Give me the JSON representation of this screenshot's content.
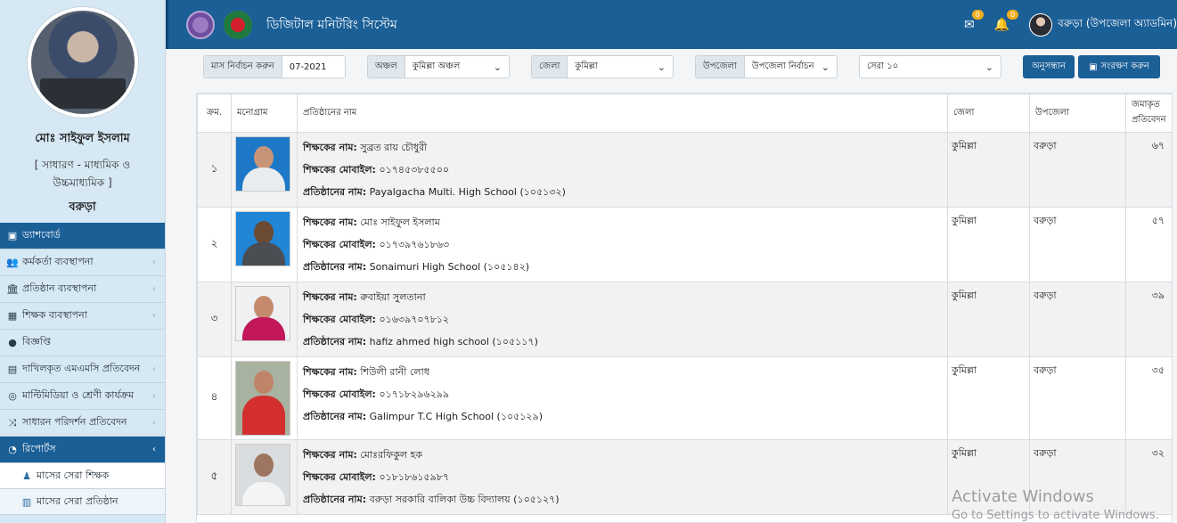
{
  "profile": {
    "name": "মোঃ সাইফুল ইসলাম",
    "category": "[ সাধারণ - মাধ্যমিক ও উচ্চমাধ্যমিক ]",
    "place": "বরুড়া"
  },
  "menu": [
    {
      "label": "ড্যাশবোর্ড",
      "icon": "dashboard-icon"
    },
    {
      "label": "কর্মকর্তা ব্যবস্থাপনা",
      "icon": "users-icon"
    },
    {
      "label": "প্রতিষ্ঠান ব্যবস্থাপনা",
      "icon": "institution-icon"
    },
    {
      "label": "শিক্ষক ব্যবস্থাপনা",
      "icon": "teacher-icon"
    },
    {
      "label": "বিজ্ঞপ্তি",
      "icon": "comment-icon"
    },
    {
      "label": "দাখিলকৃত এমএমসি প্রতিবেদন",
      "icon": "report-card-icon"
    },
    {
      "label": "মাল্টিমিডিয়া ও শ্রেণী কার্যক্রম",
      "icon": "multimedia-icon"
    },
    {
      "label": "সাধারন পরিদর্শন প্রতিবেদন",
      "icon": "shuffle-icon"
    },
    {
      "label": "রিপোর্টস",
      "icon": "pie-chart-icon"
    },
    {
      "label": "মাসের সেরা শিক্ষক",
      "icon": "teacher-small-icon"
    },
    {
      "label": "মাসের সেরা প্রতিষ্ঠান",
      "icon": "institution-small-icon"
    }
  ],
  "header": {
    "title": "ডিজিটাল মনিটরিং সিস্টেম",
    "mail_count": "0",
    "notif_count": "0",
    "user": "বরুড়া (উপজেলা অ্যাডমিন)"
  },
  "filters": {
    "month_label": "মাস নির্বাচন করুন",
    "month_value": "07-2021",
    "region_label": "অঞ্চল",
    "region_value": "কুমিল্লা অঞ্চল",
    "district_label": "জেলা",
    "district_value": "কুমিল্লা",
    "upazila_label": "উপজেলা",
    "upazila_value": "উপজেলা নির্বাচন",
    "top_value": "সেরা ১০",
    "search_label": "অনুসন্ধান",
    "save_label": "সংরক্ষণ করুন"
  },
  "table": {
    "headers": {
      "serial": "ক্রম.",
      "monogram": "মনোগ্রাম",
      "name": "প্রতিষ্ঠানের নাম",
      "district": "জেলা",
      "upazila": "উপজেলা",
      "submitted": "জমাকৃত প্রতিবেদন"
    },
    "field_labels": {
      "teacher": "শিক্ষকের নাম:",
      "mobile": "শিক্ষকের মোবাইল:",
      "institution": "প্রতিষ্ঠানের নাম:"
    },
    "rows": [
      {
        "serial": "১",
        "teacher": "সুব্রত রায় চৌধুরী",
        "mobile": "০১৭৪৫৩৮৫৫০০",
        "institution": "Payalgacha Multi. High School (১০৫১৩২)",
        "district": "কুমিল্লা",
        "upazila": "বরুড়া",
        "count": "৬৭"
      },
      {
        "serial": "২",
        "teacher": "মোঃ সাইফুল ইসলাম",
        "mobile": "০১৭৩৯৭৬১৮৬৩",
        "institution": "Sonaimuri High School (১০৫১৪২)",
        "district": "কুমিল্লা",
        "upazila": "বরুড়া",
        "count": "৫৭"
      },
      {
        "serial": "৩",
        "teacher": "রুবাইয়া সুলতানা",
        "mobile": "০১৬৩৯৭০৭৮১২",
        "institution": "hafiz ahmed high school (১০৫১১৭)",
        "district": "কুমিল্লা",
        "upazila": "বরুড়া",
        "count": "৩৯"
      },
      {
        "serial": "৪",
        "teacher": "শিউলী রানী লোধ",
        "mobile": "০১৭১৮২৯৬২৯৯",
        "institution": "Galimpur T.C High School (১০৫১২৯)",
        "district": "কুমিল্লা",
        "upazila": "বরুড়া",
        "count": "৩৫"
      },
      {
        "serial": "৫",
        "teacher": "মোঃরফিকুল হক",
        "mobile": "০১৮১৮৬১৫৯৮৭",
        "institution": "বরুড়া সরকারি বালিকা উচ্চ বিদ্যালয় (১০৫১২৭)",
        "district": "কুমিল্লা",
        "upazila": "বরুড়া",
        "count": "৩২"
      }
    ]
  },
  "watermark": {
    "line1": "Activate Windows",
    "line2": "Go to Settings to activate Windows."
  }
}
